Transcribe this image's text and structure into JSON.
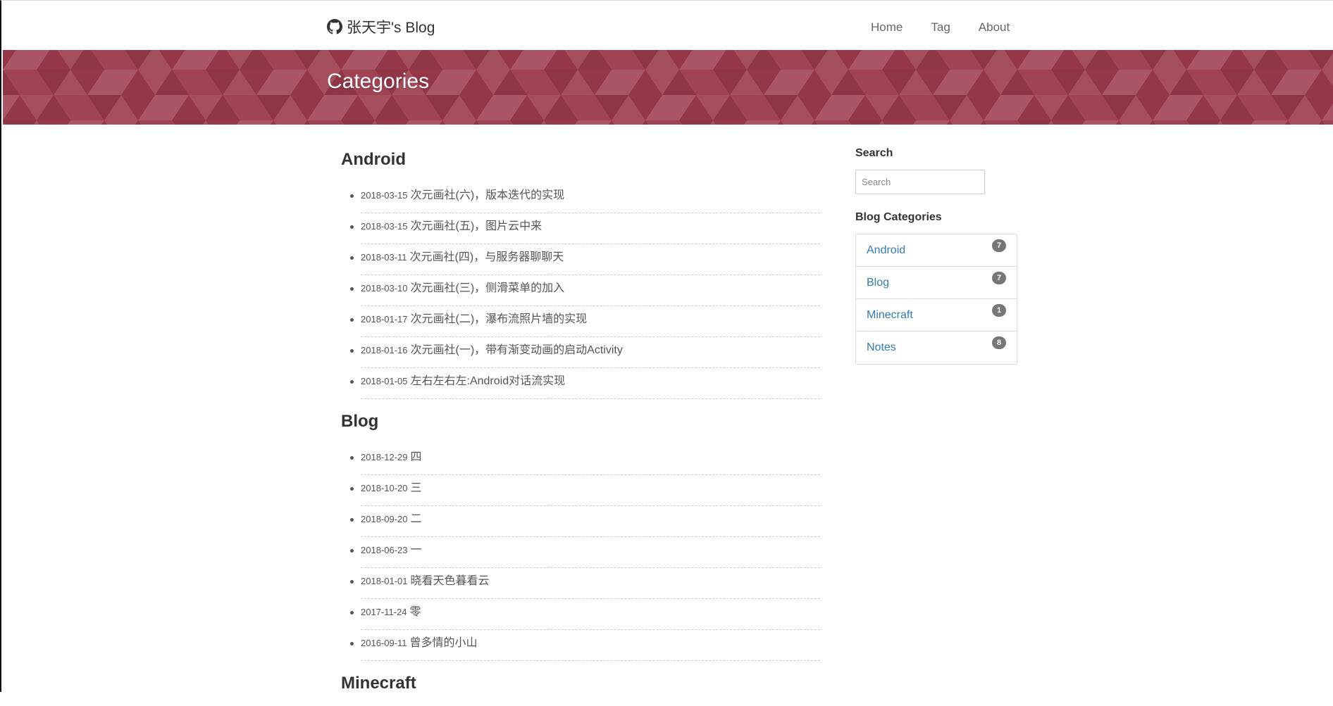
{
  "navbar": {
    "brand": "张天宇's Blog",
    "links": [
      "Home",
      "Tag",
      "About"
    ]
  },
  "banner": {
    "title": "Categories"
  },
  "categories": [
    {
      "name": "Android",
      "posts": [
        {
          "date": "2018-03-15",
          "title": "次元画社(六)，版本迭代的实现"
        },
        {
          "date": "2018-03-15",
          "title": "次元画社(五)，图片云中来"
        },
        {
          "date": "2018-03-11",
          "title": "次元画社(四)，与服务器聊聊天"
        },
        {
          "date": "2018-03-10",
          "title": "次元画社(三)，侧滑菜单的加入"
        },
        {
          "date": "2018-01-17",
          "title": "次元画社(二)，瀑布流照片墙的实现"
        },
        {
          "date": "2018-01-16",
          "title": "次元画社(一)，带有渐变动画的启动Activity"
        },
        {
          "date": "2018-01-05",
          "title": "左右左右左:Android对话流实现"
        }
      ]
    },
    {
      "name": "Blog",
      "posts": [
        {
          "date": "2018-12-29",
          "title": "四"
        },
        {
          "date": "2018-10-20",
          "title": "三"
        },
        {
          "date": "2018-09-20",
          "title": "二"
        },
        {
          "date": "2018-06-23",
          "title": "一"
        },
        {
          "date": "2018-01-01",
          "title": "晓看天色暮看云"
        },
        {
          "date": "2017-11-24",
          "title": "零"
        },
        {
          "date": "2016-09-11",
          "title": "曾多情的小山"
        }
      ]
    },
    {
      "name": "Minecraft",
      "posts": []
    }
  ],
  "sidebar": {
    "search_heading": "Search",
    "search_placeholder": "Search",
    "categories_heading": "Blog Categories",
    "category_counts": [
      {
        "name": "Android",
        "count": "7"
      },
      {
        "name": "Blog",
        "count": "7"
      },
      {
        "name": "Minecraft",
        "count": "1"
      },
      {
        "name": "Notes",
        "count": "8"
      }
    ]
  },
  "colors": {
    "banner": "#9b3a4c",
    "link": "#337ab7",
    "badge": "#777777"
  }
}
